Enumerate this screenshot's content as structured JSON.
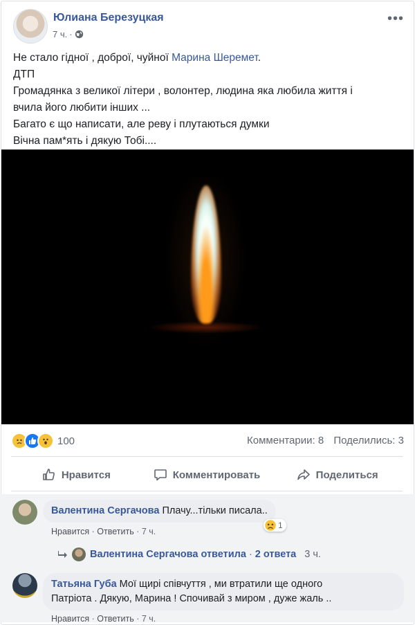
{
  "post": {
    "author": "Юлиана Березуцкая",
    "time": "7 ч.",
    "privacy_icon": "globe-icon",
    "more_label": "•••",
    "text_lines": [
      {
        "before": "Не стало гідної , доброї, чуйної ",
        "mention": "Марина Шеремет",
        "after": "."
      },
      {
        "text": "ДТП"
      },
      {
        "text": "Громадянка з великої літери , волонтер, людина яка любила життя і"
      },
      {
        "text": "вчила його любити інших ..."
      },
      {
        "text": "Багато є що написати, але реву і плутаються думки"
      },
      {
        "text": "Вічна пам*ять і дякую Тобі...."
      }
    ],
    "image": "candle-flame-photo",
    "reactions": {
      "icons": [
        "sad-reaction-icon",
        "like-reaction-icon",
        "wow-reaction-icon"
      ],
      "count": "100"
    },
    "stats": {
      "comments": "Комментарии: 8",
      "shares": "Поделились: 3"
    },
    "actions": {
      "like": "Нравится",
      "comment": "Комментировать",
      "share": "Поделиться"
    },
    "colors": {
      "link": "#385898",
      "secondary": "#606770",
      "comments_bg": "#f2f3f5",
      "bubble_bg": "#ebedf0"
    }
  },
  "comments": [
    {
      "author": "Валентина Сергачова",
      "text": "Плачу...тільки писала..",
      "like": "Нравится",
      "reply": "Ответить",
      "time": "7 ч.",
      "reaction_count": "1",
      "reaction_icon": "sad-reaction-icon",
      "replies_summary": {
        "author": "Валентина Сергачова",
        "verb": "ответила",
        "count": "2 ответа",
        "time": "3 ч."
      }
    },
    {
      "author": "Татьяна Губа",
      "text_line1": "Мої щирі співчуття , ми втратили ще одного",
      "text_line2": "Патріота . Дякую, Марина ! Спочивай з миром , дуже жаль ..",
      "like": "Нравится",
      "reply": "Ответить",
      "time": "7 ч."
    }
  ]
}
